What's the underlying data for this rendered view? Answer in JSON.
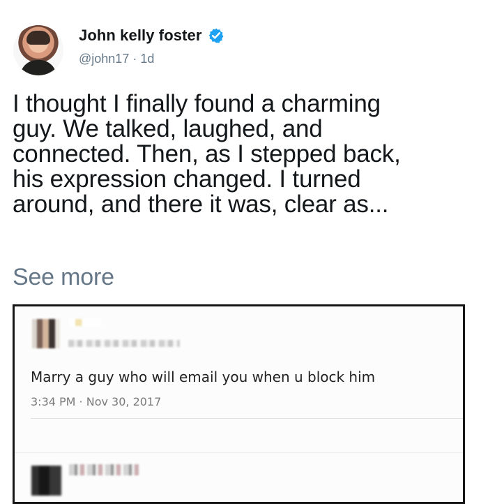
{
  "post": {
    "author": {
      "display_name": "John kelly foster",
      "handle": "@john17",
      "separator": "·",
      "age": "1d",
      "verified_icon": "verified-badge-icon",
      "avatar_icon": "profile-photo"
    },
    "text_lines": [
      "I thought I finally found a charming",
      "guy. We talked, laughed, and",
      "connected. Then, as I stepped back,",
      "his expression changed. I turned",
      "around, and there it was, clear as..."
    ],
    "see_more_label": "See more"
  },
  "embedded_screenshot": {
    "tweet_text": "Marry a guy who will email you when u block him",
    "timestamp": "3:34 PM · Nov 30, 2017"
  },
  "colors": {
    "primary_text": "#14171a",
    "secondary_text": "#657786",
    "verified_blue": "#1da1f2",
    "embedded_border": "#161616"
  }
}
